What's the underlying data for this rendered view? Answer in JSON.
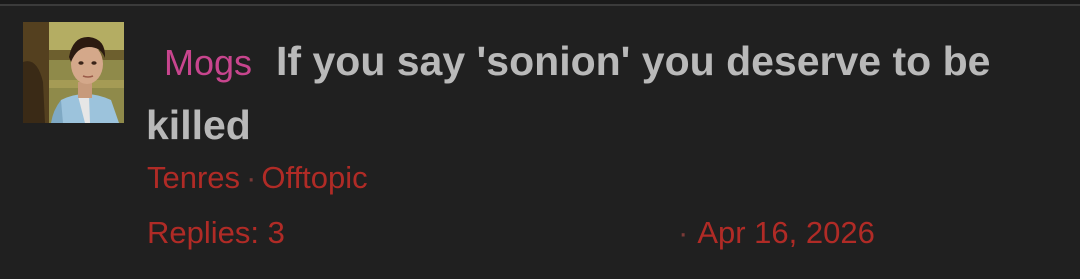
{
  "thread": {
    "author": "Mogs",
    "title": "If you say 'sonion' you deserve to be killed",
    "last_poster": "Tenres",
    "separator": "·",
    "forum": "Offtopic",
    "replies_label": "Replies: 3",
    "date": "Apr 16, 2026"
  },
  "icons": {
    "avatar": "avatar-photo"
  },
  "colors": {
    "background": "#202020",
    "title": "#b9b9b9",
    "author": "#c8458e",
    "meta": "#b02b26"
  }
}
